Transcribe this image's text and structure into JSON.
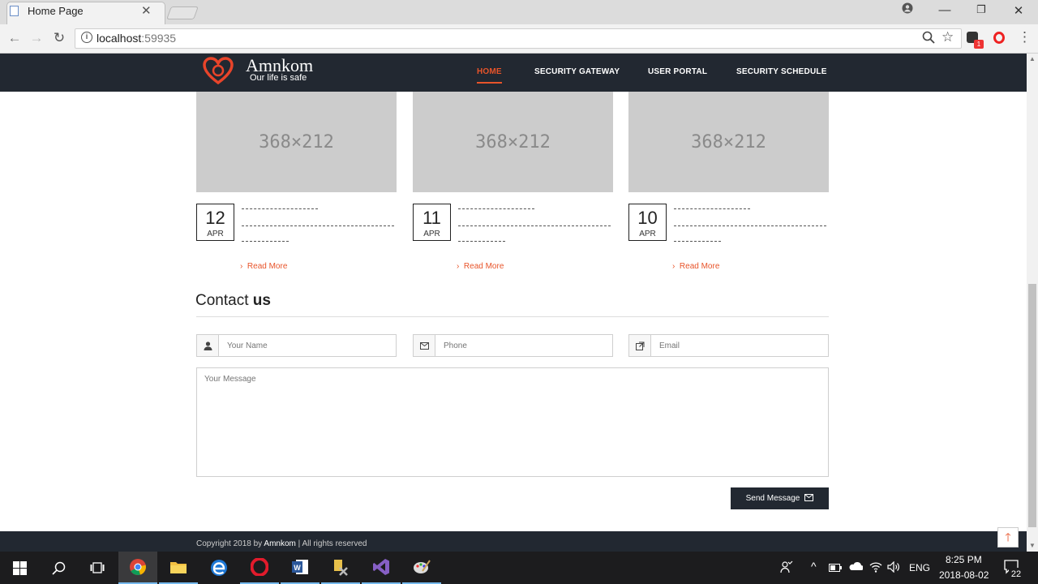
{
  "browser": {
    "tab_title": "Home Page",
    "url_host": "localhost",
    "url_port": ":59935",
    "extension_badge": "1"
  },
  "site": {
    "brand": "Amnkom",
    "tagline": "Our life is safe",
    "nav": [
      "HOME",
      "SECURITY GATEWAY",
      "USER PORTAL",
      "SECURITY SCHEDULE"
    ],
    "accent_color": "#e8542a",
    "header_color": "#222831"
  },
  "posts": [
    {
      "image_label": "368×212",
      "day": "12",
      "month": "APR",
      "read_more": "Read More"
    },
    {
      "image_label": "368×212",
      "day": "11",
      "month": "APR",
      "read_more": "Read More"
    },
    {
      "image_label": "368×212",
      "day": "10",
      "month": "APR",
      "read_more": "Read More"
    }
  ],
  "contact": {
    "title_light": "Contact",
    "title_bold": "us",
    "name_placeholder": "Your Name",
    "phone_placeholder": "Phone",
    "email_placeholder": "Email",
    "message_placeholder": "Your Message",
    "send_label": "Send Message"
  },
  "footer": {
    "copyright_prefix": "Copyright 2018 by",
    "copyright_brand": "Amnkom",
    "copyright_suffix": "| All rights reserved"
  },
  "taskbar": {
    "language": "ENG",
    "time": "8:25 PM",
    "date": "2018-08-02",
    "notifications": "22"
  }
}
